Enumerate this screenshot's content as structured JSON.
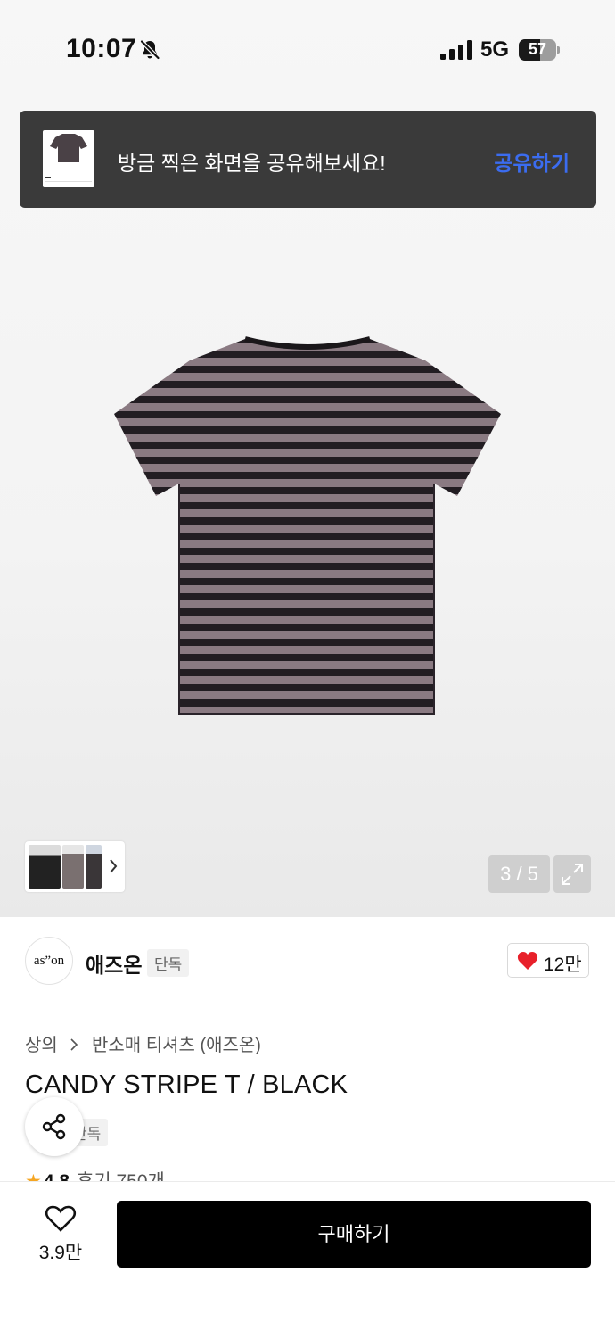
{
  "status_bar": {
    "time": "10:07",
    "network": "5G",
    "battery": "57",
    "battery_level": 0.57
  },
  "share_toast": {
    "message": "방금 찍은 화면을 공유해보세요!",
    "action": "공유하기"
  },
  "gallery": {
    "counter": "3 / 5",
    "current": 3,
    "total": 5
  },
  "brand": {
    "logo_text": "as”on",
    "name": "애즈온",
    "badge": "단독",
    "likes": "12만"
  },
  "breadcrumb": [
    "상의",
    "반소매 티셔츠 (애즈온)"
  ],
  "product": {
    "title": "CANDY STRIPE T / BLACK",
    "badge": "단독",
    "rating": "4.8",
    "reviews": "후기 750개"
  },
  "bottom_bar": {
    "wish_count": "3.9만",
    "buy_label": "구매하기"
  },
  "colors": {
    "accent_blue": "#3b6cf0",
    "heart_red": "#e8202a",
    "star": "#f5a623",
    "stripe_dark": "#221d22",
    "stripe_light": "#8a7a82"
  }
}
